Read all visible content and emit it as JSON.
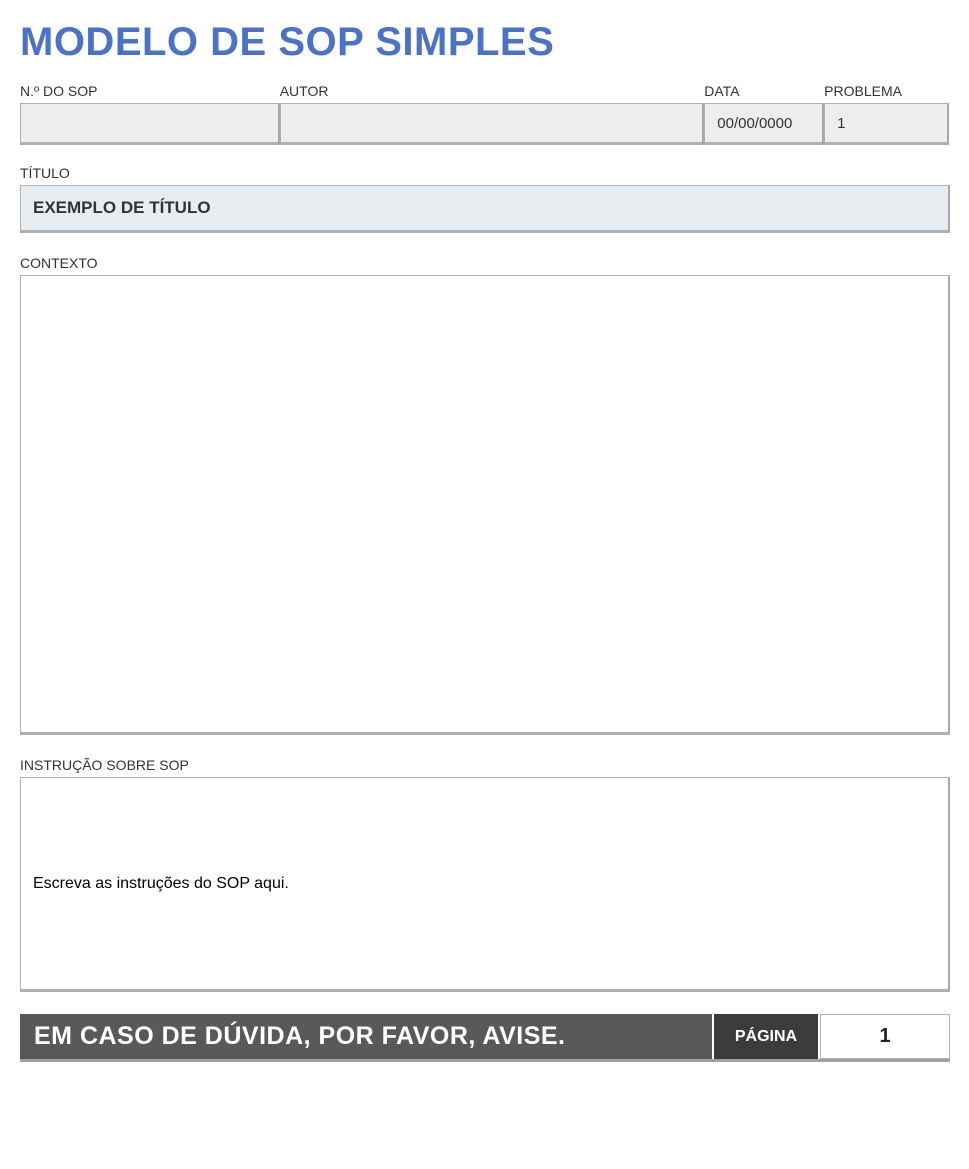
{
  "title": "MODELO DE SOP SIMPLES",
  "header": {
    "sop_label": "N.º DO SOP",
    "sop_value": "",
    "autor_label": "AUTOR",
    "autor_value": "",
    "data_label": "DATA",
    "data_value": "00/00/0000",
    "problema_label": "PROBLEMA",
    "problema_value": "1"
  },
  "titulo": {
    "label": "TÍTULO",
    "value": "EXEMPLO DE TÍTULO"
  },
  "contexto": {
    "label": "CONTEXTO",
    "value": ""
  },
  "instrucao": {
    "label": "INSTRUÇÃO SOBRE SOP",
    "value": "Escreva as instruções do SOP aqui."
  },
  "footer": {
    "message": "EM CASO DE DÚVIDA, POR FAVOR, AVISE.",
    "pagina_label": "PÁGINA",
    "pagina_num": "1"
  }
}
